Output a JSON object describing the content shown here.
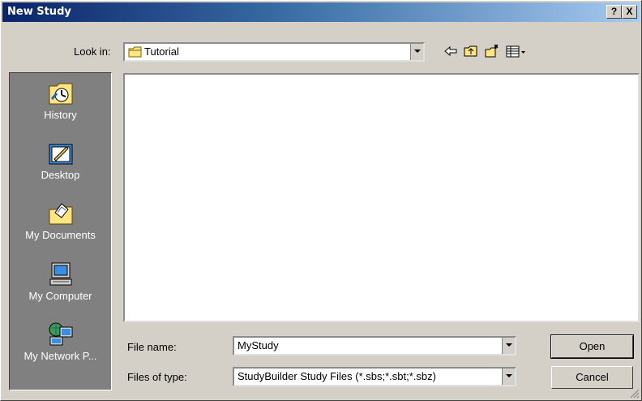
{
  "window": {
    "title": "New Study"
  },
  "titlebar_buttons": {
    "help": "?",
    "close": "X"
  },
  "look_in": {
    "label": "Look in:",
    "value": "Tutorial"
  },
  "places": [
    {
      "label": "History",
      "icon": "history-icon"
    },
    {
      "label": "Desktop",
      "icon": "desktop-icon"
    },
    {
      "label": "My Documents",
      "icon": "my-documents-icon"
    },
    {
      "label": "My Computer",
      "icon": "my-computer-icon"
    },
    {
      "label": "My Network P...",
      "icon": "my-network-places-icon"
    }
  ],
  "file_name": {
    "label": "File name:",
    "value": "MyStudy"
  },
  "file_type": {
    "label": "Files of type:",
    "value": "StudyBuilder Study Files (*.sbs;*.sbt;*.sbz)"
  },
  "buttons": {
    "open": "Open",
    "cancel": "Cancel"
  },
  "colors": {
    "title_start": "#0a246a",
    "title_end": "#a6caf0",
    "face": "#d4d0c8",
    "places_bg": "#808080"
  }
}
